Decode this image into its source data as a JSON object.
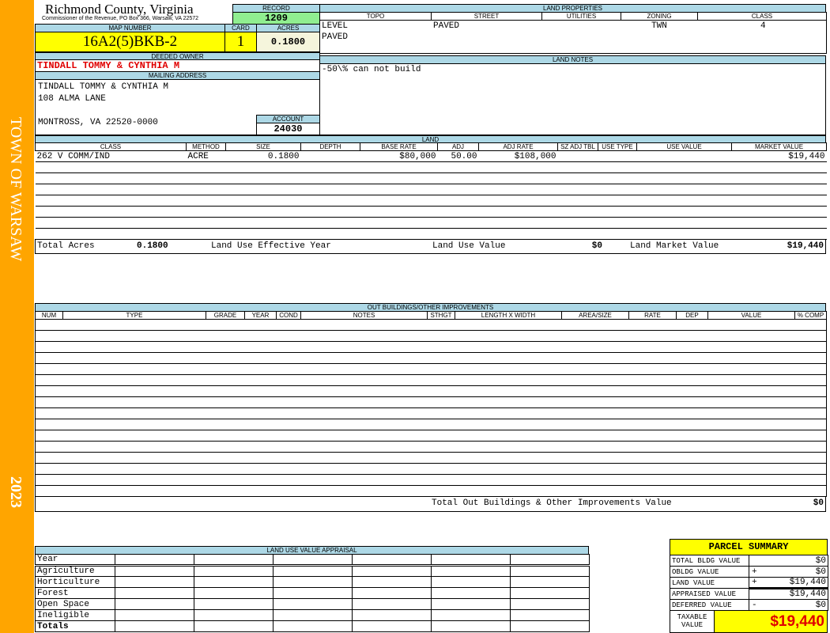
{
  "sidebar": {
    "town": "TOWN OF WARSAW",
    "year": "2023"
  },
  "header": {
    "county": "Richmond County, Virginia",
    "office": "Commissioner of the Revenue, PO Box 366, Warsaw, VA 22572"
  },
  "record": {
    "label": "RECORD",
    "value": "1209"
  },
  "map": {
    "label": "MAP NUMBER",
    "value": "16A2(5)BKB-2"
  },
  "card": {
    "label": "CARD",
    "value": "1"
  },
  "acres": {
    "label": "ACRES",
    "value": "0.1800"
  },
  "owner": {
    "label": "DEEDED OWNER",
    "value": "TINDALL TOMMY & CYNTHIA M"
  },
  "mailing": {
    "label": "MAILING ADDRESS",
    "lines": [
      "TINDALL TOMMY & CYNTHIA M",
      "108 ALMA LANE",
      "",
      "MONTROSS, VA 22520-0000"
    ]
  },
  "account": {
    "label": "ACCOUNT",
    "value": "24030"
  },
  "land_properties": {
    "title": "LAND PROPERTIES",
    "columns": [
      "TOPO",
      "STREET",
      "UTILITIES",
      "ZONING",
      "CLASS"
    ],
    "rows": [
      [
        "LEVEL",
        "PAVED",
        "",
        "TWN",
        "4"
      ],
      [
        "PAVED",
        "",
        "",
        "",
        ""
      ]
    ]
  },
  "land_notes": {
    "title": "LAND NOTES",
    "text": "-50\\% can not build"
  },
  "land": {
    "title": "LAND",
    "columns": [
      "CLASS",
      "METHOD",
      "SIZE",
      "DEPTH",
      "BASE RATE",
      "ADJ",
      "ADJ RATE",
      "SZ ADJ TBL",
      "USE TYPE",
      "USE VALUE",
      "MARKET VALUE"
    ],
    "rows": [
      [
        "262 V COMM/IND",
        "ACRE",
        "0.1800",
        "",
        "$80,000",
        "50.00",
        "$108,000",
        "",
        "",
        "",
        "$19,440"
      ]
    ],
    "totals": {
      "acres_label": "Total Acres",
      "acres": "0.1800",
      "effyear_label": "Land Use Effective Year",
      "effyear": "",
      "usevalue_label": "Land Use Value",
      "usevalue": "$0",
      "market_label": "Land Market Value",
      "market": "$19,440"
    }
  },
  "outbuildings": {
    "title": "OUT BUILDINGS/OTHER IMPROVEMENTS",
    "columns": [
      "NUM",
      "TYPE",
      "GRADE",
      "YEAR",
      "COND",
      "NOTES",
      "STHGT",
      "LENGTH X WIDTH",
      "AREA/SIZE",
      "RATE",
      "DEP",
      "VALUE",
      "% COMP"
    ],
    "total_label": "Total Out Buildings & Other Improvements Value",
    "total": "$0"
  },
  "land_use": {
    "title": "LAND USE VALUE APPRAISAL",
    "year_label": "Year",
    "rows": [
      "Agriculture",
      "Horticulture",
      "Forest",
      "Open Space",
      "Ineligible"
    ],
    "totals_label": "Totals"
  },
  "parcel_summary": {
    "title": "PARCEL SUMMARY",
    "rows": [
      {
        "label": "TOTAL BLDG VALUE",
        "op": "",
        "value": "$0"
      },
      {
        "label": "OBLDG VALUE",
        "op": "+",
        "value": "$0"
      },
      {
        "label": "LAND VALUE",
        "op": "+",
        "value": "$19,440"
      },
      {
        "label": "APPRAISED VALUE",
        "op": "",
        "value": "$19,440"
      },
      {
        "label": "DEFERRED VALUE",
        "op": "-",
        "value": "$0"
      }
    ],
    "taxable_label": "TAXABLE VALUE",
    "taxable": "$19,440"
  },
  "colors": {
    "sidebar": "#ffa500",
    "header": "#add8e6",
    "record": "#90ee90",
    "highlight": "#ffff00",
    "owner": "#e00000"
  }
}
